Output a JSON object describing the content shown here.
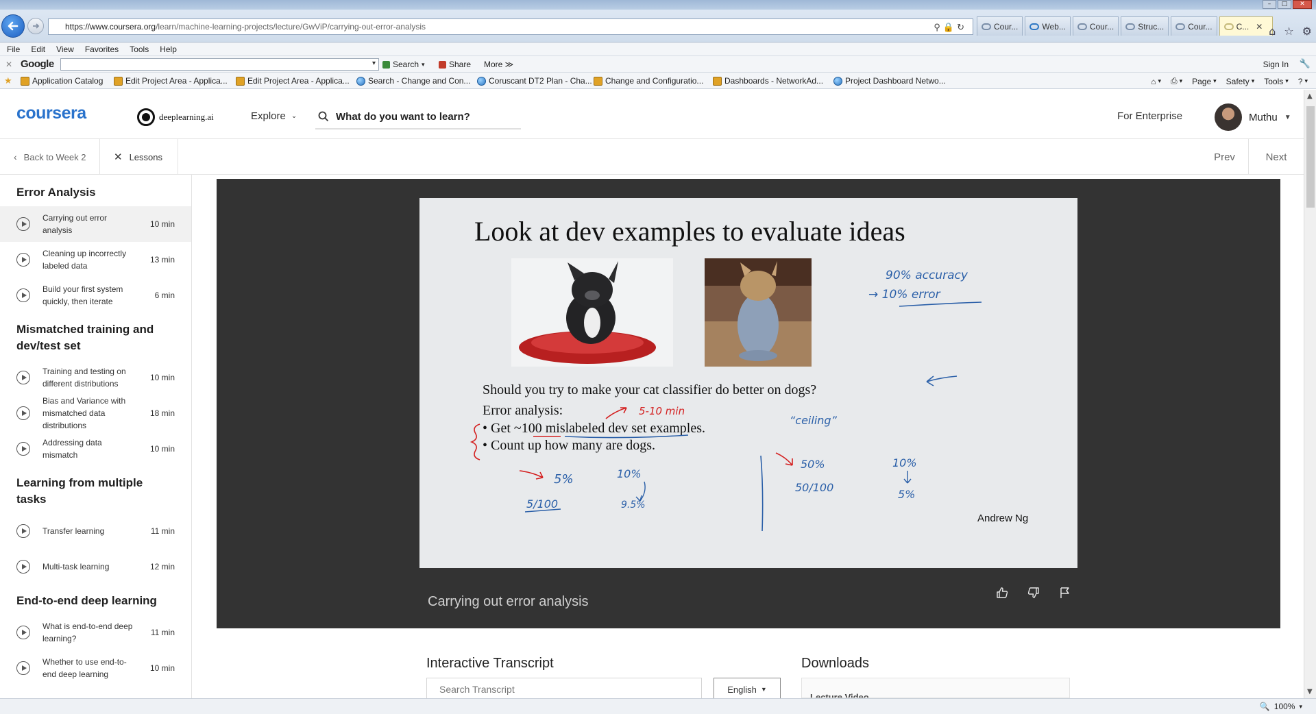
{
  "browser": {
    "url_host": "https://www.coursera.org",
    "url_path": "/learn/machine-learning-projects/lecture/GwViP/carrying-out-error-analysis",
    "tabs": [
      {
        "label": "Cour...",
        "active": false,
        "color": "#7a8ea8"
      },
      {
        "label": "Web...",
        "active": false,
        "color": "#2e78c4"
      },
      {
        "label": "Cour...",
        "active": false,
        "color": "#7a8ea8"
      },
      {
        "label": "Struc...",
        "active": false,
        "color": "#7a8ea8"
      },
      {
        "label": "Cour...",
        "active": false,
        "color": "#7a8ea8"
      },
      {
        "label": "C...",
        "active": true,
        "color": "#c4b97a"
      }
    ],
    "menu": [
      "File",
      "Edit",
      "View",
      "Favorites",
      "Tools",
      "Help"
    ],
    "google_bar": {
      "logo": "Google",
      "search_label": "Search",
      "share_label": "Share",
      "more_label": "More ≫",
      "signin_label": "Sign In"
    },
    "favorites": [
      "Application Catalog",
      "Edit Project Area - Applica...",
      "Edit Project Area - Applica...",
      "Search - Change and Con...",
      "Coruscant DT2 Plan - Cha...",
      "Change and Configuratio...",
      "Dashboards - NetworkAd...",
      "Project Dashboard Netwo..."
    ],
    "command_bar": {
      "page": "Page",
      "safety": "Safety",
      "tools": "Tools"
    },
    "zoom": "100%"
  },
  "site": {
    "logo": "coursera",
    "partner": "deeplearning.ai",
    "explore": "Explore",
    "search_placeholder": "What do you want to learn?",
    "enterprise": "For Enterprise",
    "user_name": "Muthu",
    "brand_color": "#2a73cc"
  },
  "lesson_bar": {
    "back": "Back to Week 2",
    "lessons": "Lessons",
    "prev": "Prev",
    "next": "Next"
  },
  "sidebar": {
    "sections": [
      {
        "title": "Error Analysis",
        "items": [
          {
            "label": "Carrying out error analysis",
            "duration": "10 min",
            "active": true
          },
          {
            "label": "Cleaning up incorrectly labeled data",
            "duration": "13 min"
          },
          {
            "label": "Build your first system quickly, then iterate",
            "duration": "6 min"
          }
        ]
      },
      {
        "title": "Mismatched training and dev/test set",
        "items": [
          {
            "label": "Training and testing on different distributions",
            "duration": "10 min"
          },
          {
            "label": "Bias and Variance with mismatched data distributions",
            "duration": "18 min"
          },
          {
            "label": "Addressing data mismatch",
            "duration": "10 min"
          }
        ]
      },
      {
        "title": "Learning from multiple tasks",
        "items": [
          {
            "label": "Transfer learning",
            "duration": "11 min"
          },
          {
            "label": "Multi-task learning",
            "duration": "12 min"
          }
        ]
      },
      {
        "title": "End-to-end deep learning",
        "items": [
          {
            "label": "What is end-to-end deep learning?",
            "duration": "11 min"
          },
          {
            "label": "Whether to use end-to-end deep learning",
            "duration": "10 min"
          }
        ]
      }
    ]
  },
  "slide": {
    "title": "Look at dev examples to evaluate ideas",
    "question": "Should you try to make your cat classifier do better on dogs?",
    "analysis_heading": "Error analysis:",
    "bullets": [
      "Get ~100 mislabeled dev set examples.",
      "Count up how many are dogs."
    ],
    "author": "Andrew Ng",
    "handwritten": {
      "accuracy": "90% accuracy",
      "error": "→ 10% error",
      "time": "5-10 min",
      "ceiling": "“ceiling”",
      "left_pct": "5%",
      "left_frac": "5/100",
      "left_err": "10%",
      "left_new": "9.5%",
      "right_pct": "50%",
      "right_frac": "50/100",
      "right_err": "10%",
      "right_new": "5%"
    },
    "ink_blue": "#2a5fa8",
    "ink_red": "#d42020"
  },
  "video": {
    "title": "Carrying out error analysis"
  },
  "transcript": {
    "title": "Interactive Transcript",
    "search_placeholder": "Search Transcript",
    "language": "English"
  },
  "downloads": {
    "title": "Downloads",
    "first_item": "Lecture Video"
  }
}
